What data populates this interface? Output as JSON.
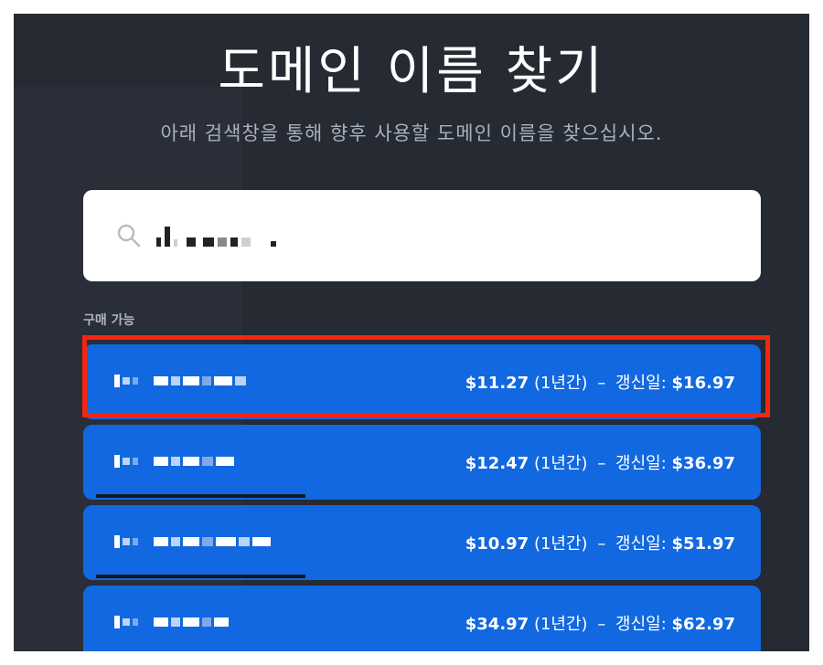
{
  "modal": {
    "title": "도메인 이름 찾기",
    "subtitle": "아래 검색창을 통해 향후 사용할 도메인 이름을 찾으십시오."
  },
  "search": {
    "icon": "search-icon",
    "value": "[redacted]"
  },
  "section_label": "구매 가능",
  "results": [
    {
      "name": "[redacted]",
      "price": "$11.27",
      "period": "(1년간)",
      "dash": "–",
      "renewal_label": "갱신일:",
      "renewal_price": "$16.97"
    },
    {
      "name": "[redacted]",
      "price": "$12.47",
      "period": "(1년간)",
      "dash": "–",
      "renewal_label": "갱신일:",
      "renewal_price": "$36.97"
    },
    {
      "name": "[redacted]",
      "price": "$10.97",
      "period": "(1년간)",
      "dash": "–",
      "renewal_label": "갱신일:",
      "renewal_price": "$51.97"
    },
    {
      "name": "[redacted]",
      "price": "$34.97",
      "period": "(1년간)",
      "dash": "–",
      "renewal_label": "갱신일:",
      "renewal_price": "$62.97"
    }
  ],
  "colors": {
    "background": "#262a33",
    "result_bg": "#1168e0",
    "highlight": "#f4260f"
  }
}
